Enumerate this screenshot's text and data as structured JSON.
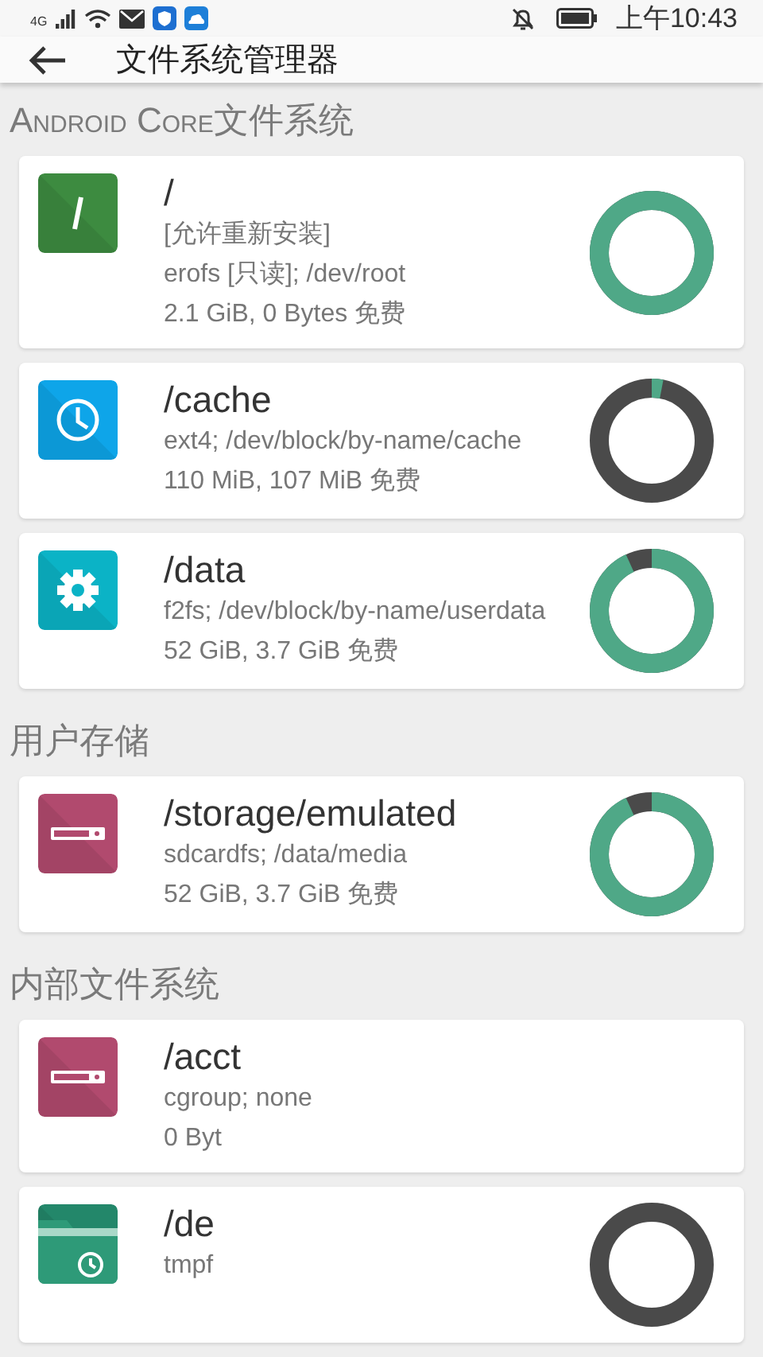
{
  "status_bar": {
    "network": "4G",
    "time": "上午10:43"
  },
  "app_bar": {
    "title": "文件系统管理器"
  },
  "sections": [
    {
      "title": "Android Core文件系统",
      "items": [
        {
          "kind": "slash",
          "name": "/",
          "lines": [
            "[允许重新安装]",
            "erofs [只读]; /dev/root",
            "2.1 GiB, 0 Bytes 免费"
          ],
          "level": 1.0
        },
        {
          "kind": "clock",
          "name": "/cache",
          "lines": [
            "ext4; /dev/block/by-name/cache",
            "110 MiB, 107 MiB 免费"
          ],
          "level": 0.03
        },
        {
          "kind": "gear",
          "name": "/data",
          "lines": [
            "f2fs; /dev/block/by-name/userdata",
            "52 GiB, 3.7 GiB 免费"
          ],
          "level": 0.93
        }
      ]
    },
    {
      "title": "用户存储",
      "items": [
        {
          "kind": "drive",
          "name": "/storage/emulated",
          "lines": [
            "sdcardfs; /data/media",
            "52 GiB, 3.7 GiB 免费"
          ],
          "level": 0.93
        }
      ]
    },
    {
      "title": "内部文件系统",
      "items": [
        {
          "kind": "drive",
          "name": "/acct",
          "lines": [
            "cgroup; none",
            "0 Byt"
          ]
        },
        {
          "kind": "folder",
          "name": "/de",
          "lines": [
            "tmpf"
          ],
          "level": 0
        }
      ]
    }
  ]
}
